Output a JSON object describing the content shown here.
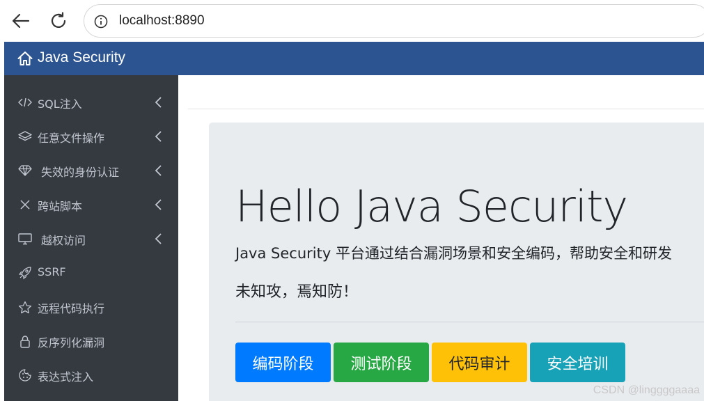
{
  "browser": {
    "url": "localhost:8890"
  },
  "header": {
    "brand": "Java Security"
  },
  "sidebar": {
    "items": [
      {
        "label": "SQL注入",
        "icon": "code-icon",
        "has_submenu": true
      },
      {
        "label": "任意文件操作",
        "icon": "layers-icon",
        "has_submenu": true
      },
      {
        "label": "失效的身份认证",
        "icon": "gem-icon",
        "has_submenu": true
      },
      {
        "label": "跨站脚本",
        "icon": "x-icon",
        "has_submenu": true
      },
      {
        "label": "越权访问",
        "icon": "monitor-icon",
        "has_submenu": true
      },
      {
        "label": "SSRF",
        "icon": "rocket-icon",
        "has_submenu": false
      },
      {
        "label": "远程代码执行",
        "icon": "star-icon",
        "has_submenu": false
      },
      {
        "label": "反序列化漏洞",
        "icon": "lock-icon",
        "has_submenu": false
      },
      {
        "label": "表达式注入",
        "icon": "cookie-icon",
        "has_submenu": false
      }
    ]
  },
  "main": {
    "title": "Hello Java Security",
    "lead": "Java Security 平台通过结合漏洞场景和安全编码，帮助安全和研发",
    "motto": "未知攻，焉知防！",
    "buttons": [
      {
        "label": "编码阶段"
      },
      {
        "label": "测试阶段"
      },
      {
        "label": "代码审计"
      },
      {
        "label": "安全培训"
      }
    ]
  },
  "watermark": "CSDN @linggggaaaa",
  "colors": {
    "header_bg": "#2c5491",
    "sidebar_bg": "#343a40",
    "jumbotron_bg": "#e9ecef",
    "btn_primary": "#007bff",
    "btn_success": "#28a745",
    "btn_warning": "#ffc107",
    "btn_info": "#17a2b8"
  }
}
